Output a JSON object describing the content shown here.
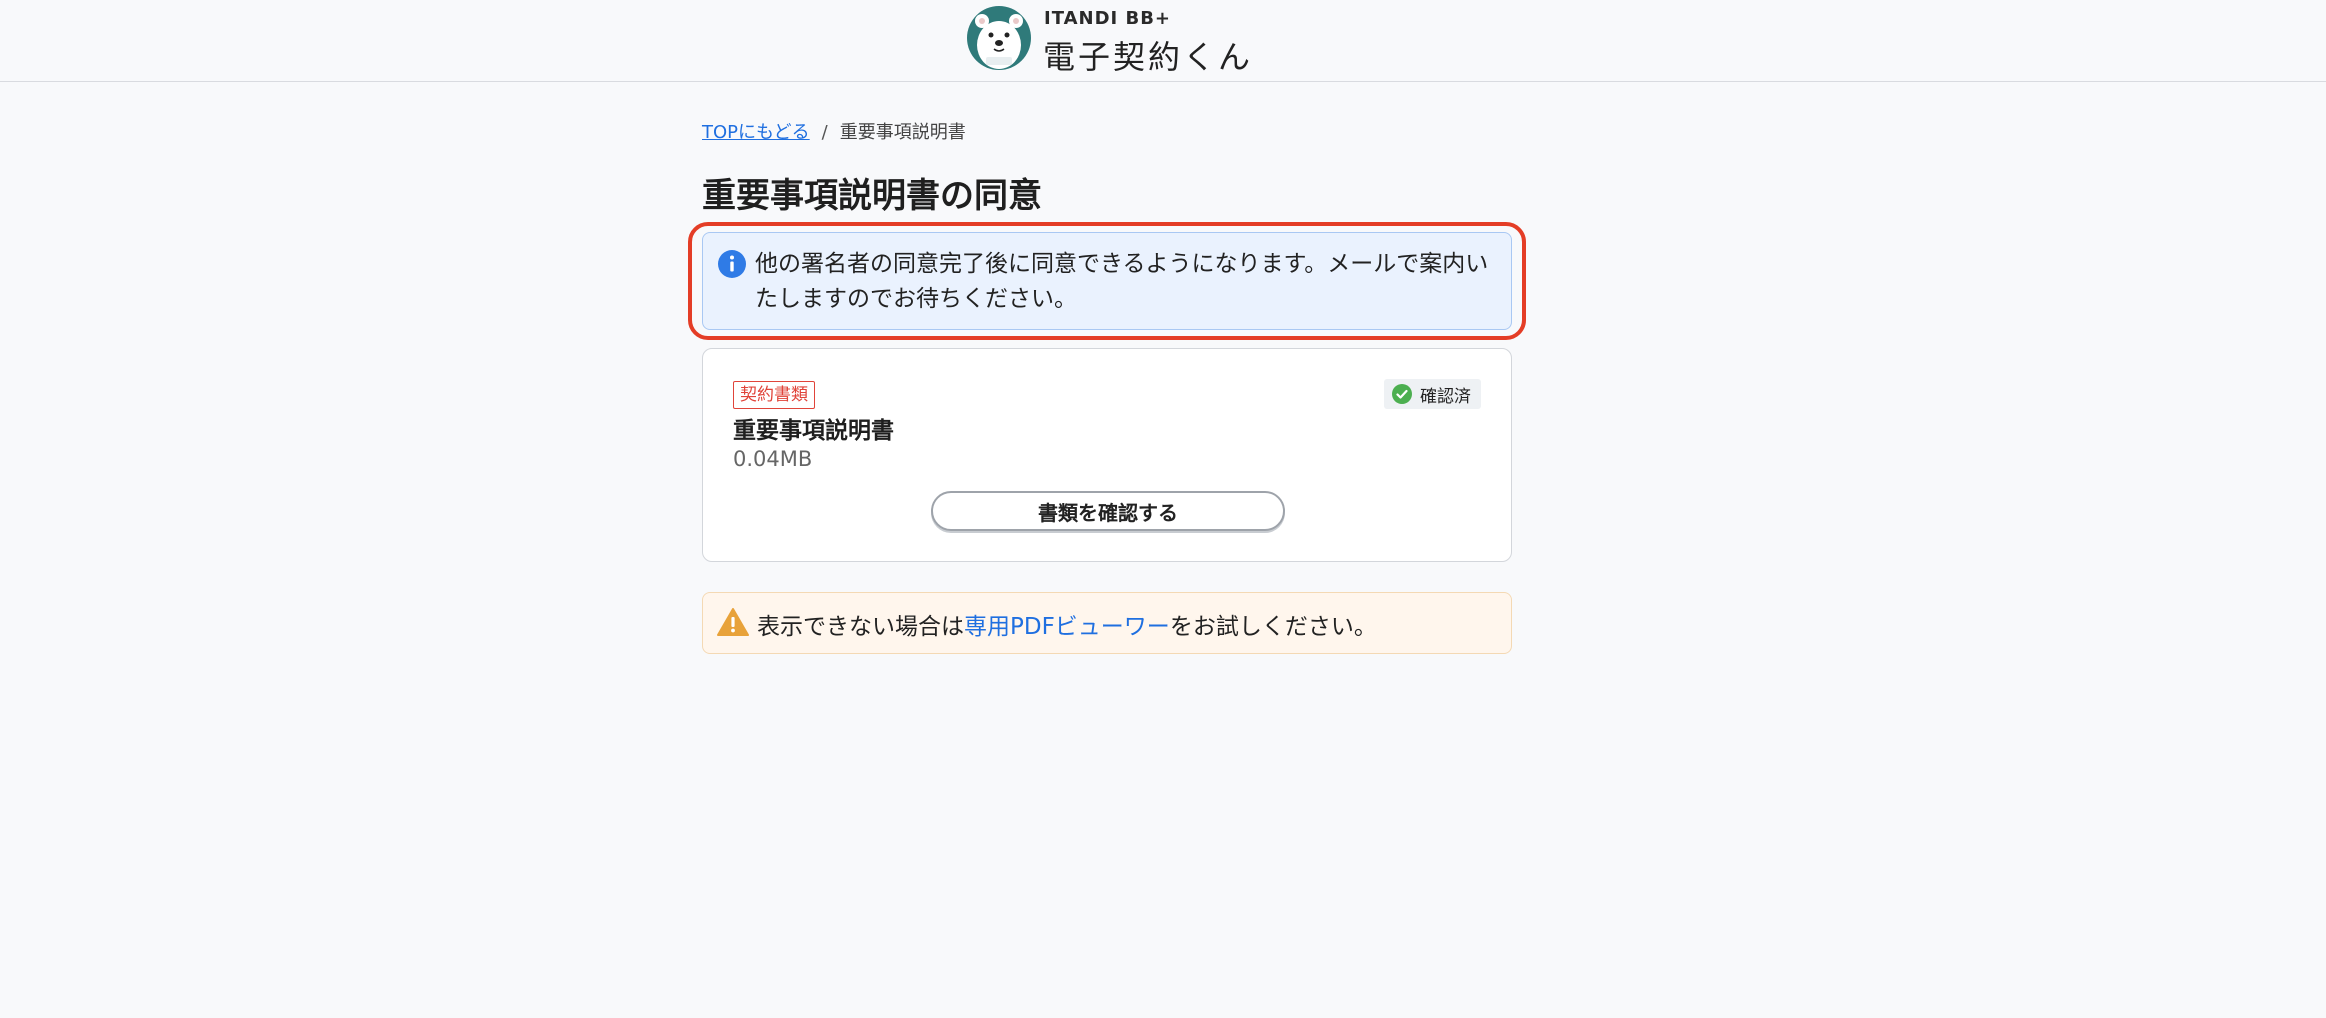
{
  "header": {
    "brand": "ITANDI BB+",
    "app_name": "電子契約くん"
  },
  "breadcrumb": {
    "top_link": "TOPにもどる",
    "separator": "/",
    "current": "重要事項説明書"
  },
  "page_title": "重要事項説明書の同意",
  "notice": {
    "message": "他の署名者の同意完了後に同意できるようになります。メールで案内いたしますのでお待ちください。"
  },
  "document_card": {
    "tag": "契約書類",
    "status": "確認済",
    "title": "重要事項説明書",
    "size": "0.04MB",
    "button_label": "書類を確認する"
  },
  "warning": {
    "prefix": "表示できない場合は",
    "link": "専用PDFビューワー",
    "suffix": "をお試しください。"
  },
  "colors": {
    "accent_blue": "#1f6fe0",
    "alert_red": "#e43d26",
    "success_green": "#4caf50",
    "warning_orange": "#e8a23a"
  }
}
